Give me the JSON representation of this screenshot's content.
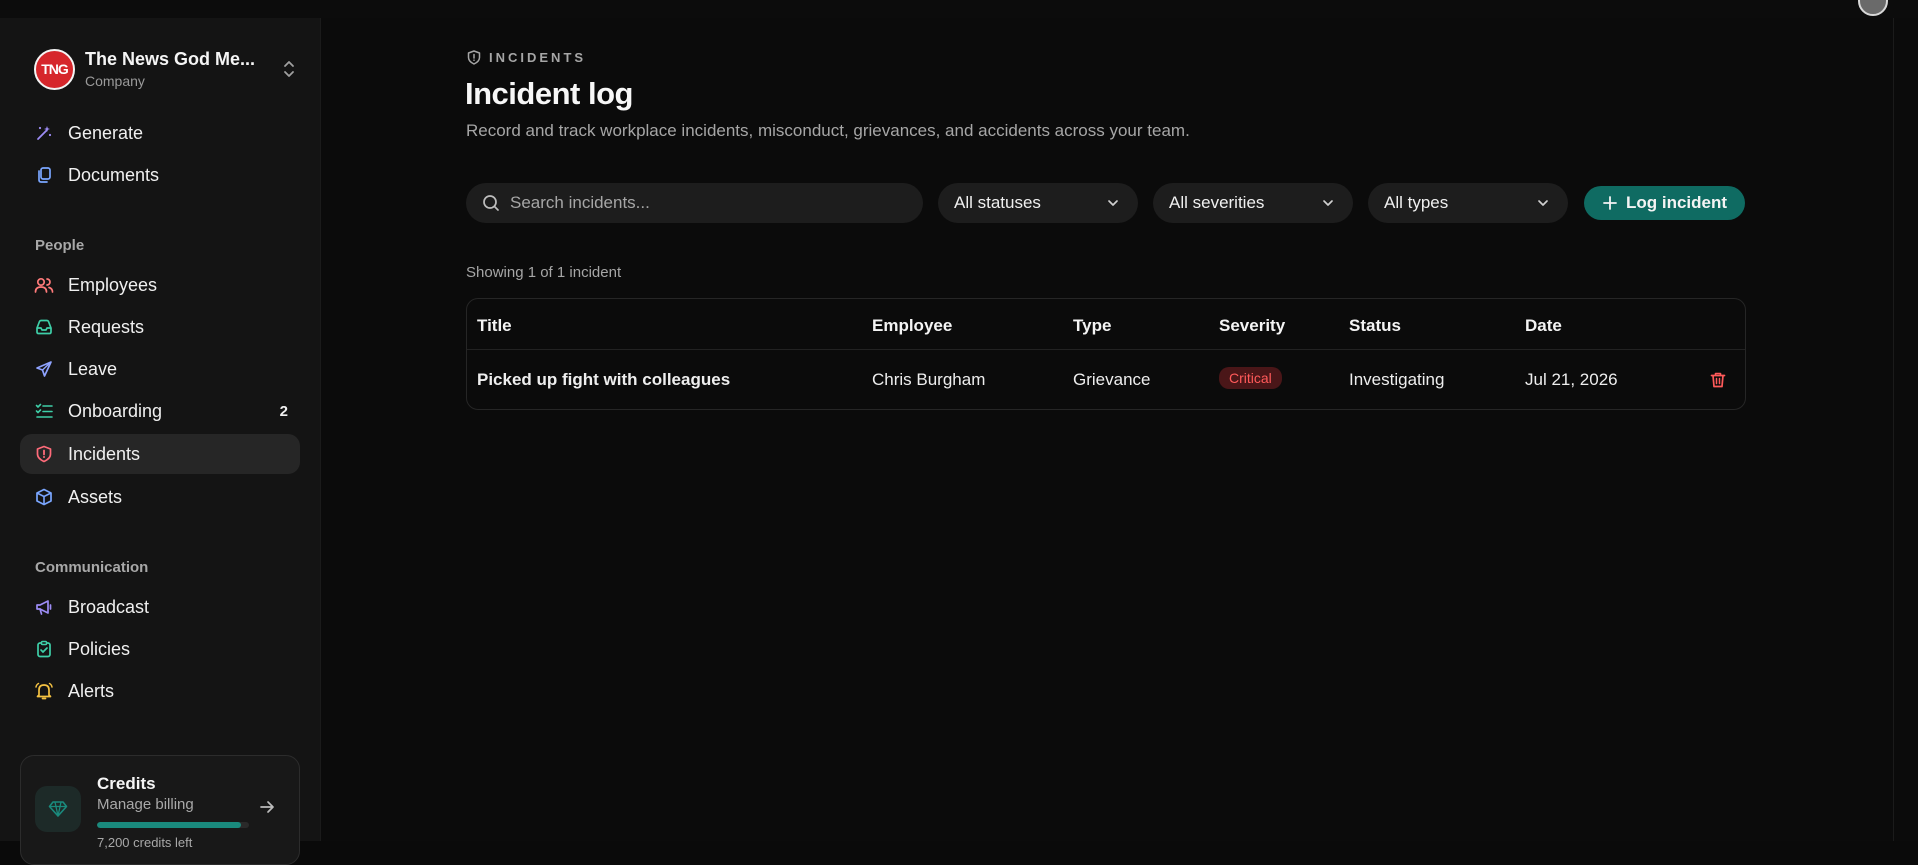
{
  "sidebar": {
    "org": {
      "logo_text": "TNG",
      "name": "The News God Me...",
      "subtitle": "Company"
    },
    "primary": [
      {
        "label": "Generate",
        "icon": "wand-icon"
      },
      {
        "label": "Documents",
        "icon": "documents-icon"
      }
    ],
    "people_label": "People",
    "people": [
      {
        "label": "Employees",
        "icon": "users-icon"
      },
      {
        "label": "Requests",
        "icon": "inbox-icon"
      },
      {
        "label": "Leave",
        "icon": "plane-icon"
      },
      {
        "label": "Onboarding",
        "icon": "checklist-icon",
        "badge": "2"
      },
      {
        "label": "Incidents",
        "icon": "shield-alert-icon",
        "active": true
      },
      {
        "label": "Assets",
        "icon": "box-icon"
      }
    ],
    "communication_label": "Communication",
    "communication": [
      {
        "label": "Broadcast",
        "icon": "megaphone-icon"
      },
      {
        "label": "Policies",
        "icon": "clipboard-check-icon"
      },
      {
        "label": "Alerts",
        "icon": "bell-icon"
      }
    ],
    "credits": {
      "title": "Credits",
      "subtitle": "Manage billing",
      "remaining_label": "7,200 credits left",
      "fill_percent": 95
    }
  },
  "header": {
    "eyebrow": "INCIDENTS",
    "title": "Incident log",
    "description": "Record and track workplace incidents, misconduct, grievances, and accidents across your team."
  },
  "filters": {
    "search_placeholder": "Search incidents...",
    "status": "All statuses",
    "severity": "All severities",
    "type": "All types",
    "log_button": "Log incident"
  },
  "results": {
    "showing": "Showing 1 of 1 incident"
  },
  "table": {
    "columns": [
      "Title",
      "Employee",
      "Type",
      "Severity",
      "Status",
      "Date"
    ],
    "rows": [
      {
        "title": "Picked up fight with colleagues",
        "employee": "Chris Burgham",
        "type": "Grievance",
        "severity": "Critical",
        "status": "Investigating",
        "date": "Jul 21, 2026"
      }
    ]
  },
  "colors": {
    "accent": "#0f6b62",
    "critical": "#ff5a5a",
    "background": "#0b0b0b"
  }
}
